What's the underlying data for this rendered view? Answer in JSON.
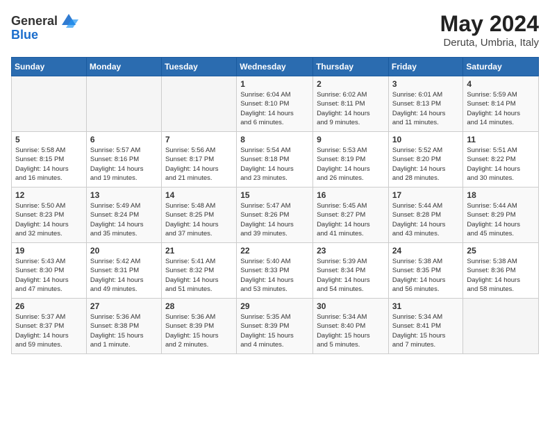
{
  "header": {
    "logo_general": "General",
    "logo_blue": "Blue",
    "title": "May 2024",
    "location": "Deruta, Umbria, Italy"
  },
  "weekdays": [
    "Sunday",
    "Monday",
    "Tuesday",
    "Wednesday",
    "Thursday",
    "Friday",
    "Saturday"
  ],
  "weeks": [
    [
      {
        "day": "",
        "info": ""
      },
      {
        "day": "",
        "info": ""
      },
      {
        "day": "",
        "info": ""
      },
      {
        "day": "1",
        "info": "Sunrise: 6:04 AM\nSunset: 8:10 PM\nDaylight: 14 hours\nand 6 minutes."
      },
      {
        "day": "2",
        "info": "Sunrise: 6:02 AM\nSunset: 8:11 PM\nDaylight: 14 hours\nand 9 minutes."
      },
      {
        "day": "3",
        "info": "Sunrise: 6:01 AM\nSunset: 8:13 PM\nDaylight: 14 hours\nand 11 minutes."
      },
      {
        "day": "4",
        "info": "Sunrise: 5:59 AM\nSunset: 8:14 PM\nDaylight: 14 hours\nand 14 minutes."
      }
    ],
    [
      {
        "day": "5",
        "info": "Sunrise: 5:58 AM\nSunset: 8:15 PM\nDaylight: 14 hours\nand 16 minutes."
      },
      {
        "day": "6",
        "info": "Sunrise: 5:57 AM\nSunset: 8:16 PM\nDaylight: 14 hours\nand 19 minutes."
      },
      {
        "day": "7",
        "info": "Sunrise: 5:56 AM\nSunset: 8:17 PM\nDaylight: 14 hours\nand 21 minutes."
      },
      {
        "day": "8",
        "info": "Sunrise: 5:54 AM\nSunset: 8:18 PM\nDaylight: 14 hours\nand 23 minutes."
      },
      {
        "day": "9",
        "info": "Sunrise: 5:53 AM\nSunset: 8:19 PM\nDaylight: 14 hours\nand 26 minutes."
      },
      {
        "day": "10",
        "info": "Sunrise: 5:52 AM\nSunset: 8:20 PM\nDaylight: 14 hours\nand 28 minutes."
      },
      {
        "day": "11",
        "info": "Sunrise: 5:51 AM\nSunset: 8:22 PM\nDaylight: 14 hours\nand 30 minutes."
      }
    ],
    [
      {
        "day": "12",
        "info": "Sunrise: 5:50 AM\nSunset: 8:23 PM\nDaylight: 14 hours\nand 32 minutes."
      },
      {
        "day": "13",
        "info": "Sunrise: 5:49 AM\nSunset: 8:24 PM\nDaylight: 14 hours\nand 35 minutes."
      },
      {
        "day": "14",
        "info": "Sunrise: 5:48 AM\nSunset: 8:25 PM\nDaylight: 14 hours\nand 37 minutes."
      },
      {
        "day": "15",
        "info": "Sunrise: 5:47 AM\nSunset: 8:26 PM\nDaylight: 14 hours\nand 39 minutes."
      },
      {
        "day": "16",
        "info": "Sunrise: 5:45 AM\nSunset: 8:27 PM\nDaylight: 14 hours\nand 41 minutes."
      },
      {
        "day": "17",
        "info": "Sunrise: 5:44 AM\nSunset: 8:28 PM\nDaylight: 14 hours\nand 43 minutes."
      },
      {
        "day": "18",
        "info": "Sunrise: 5:44 AM\nSunset: 8:29 PM\nDaylight: 14 hours\nand 45 minutes."
      }
    ],
    [
      {
        "day": "19",
        "info": "Sunrise: 5:43 AM\nSunset: 8:30 PM\nDaylight: 14 hours\nand 47 minutes."
      },
      {
        "day": "20",
        "info": "Sunrise: 5:42 AM\nSunset: 8:31 PM\nDaylight: 14 hours\nand 49 minutes."
      },
      {
        "day": "21",
        "info": "Sunrise: 5:41 AM\nSunset: 8:32 PM\nDaylight: 14 hours\nand 51 minutes."
      },
      {
        "day": "22",
        "info": "Sunrise: 5:40 AM\nSunset: 8:33 PM\nDaylight: 14 hours\nand 53 minutes."
      },
      {
        "day": "23",
        "info": "Sunrise: 5:39 AM\nSunset: 8:34 PM\nDaylight: 14 hours\nand 54 minutes."
      },
      {
        "day": "24",
        "info": "Sunrise: 5:38 AM\nSunset: 8:35 PM\nDaylight: 14 hours\nand 56 minutes."
      },
      {
        "day": "25",
        "info": "Sunrise: 5:38 AM\nSunset: 8:36 PM\nDaylight: 14 hours\nand 58 minutes."
      }
    ],
    [
      {
        "day": "26",
        "info": "Sunrise: 5:37 AM\nSunset: 8:37 PM\nDaylight: 14 hours\nand 59 minutes."
      },
      {
        "day": "27",
        "info": "Sunrise: 5:36 AM\nSunset: 8:38 PM\nDaylight: 15 hours\nand 1 minute."
      },
      {
        "day": "28",
        "info": "Sunrise: 5:36 AM\nSunset: 8:39 PM\nDaylight: 15 hours\nand 2 minutes."
      },
      {
        "day": "29",
        "info": "Sunrise: 5:35 AM\nSunset: 8:39 PM\nDaylight: 15 hours\nand 4 minutes."
      },
      {
        "day": "30",
        "info": "Sunrise: 5:34 AM\nSunset: 8:40 PM\nDaylight: 15 hours\nand 5 minutes."
      },
      {
        "day": "31",
        "info": "Sunrise: 5:34 AM\nSunset: 8:41 PM\nDaylight: 15 hours\nand 7 minutes."
      },
      {
        "day": "",
        "info": ""
      }
    ]
  ]
}
